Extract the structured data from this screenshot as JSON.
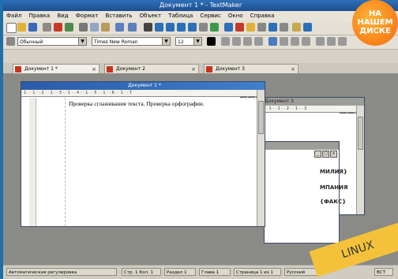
{
  "window": {
    "title": "Документ 1 * - TextMaker"
  },
  "menu": [
    "Файл",
    "Правка",
    "Вид",
    "Формат",
    "Вставить",
    "Объект",
    "Таблица",
    "Сервис",
    "Окно",
    "Справка"
  ],
  "format_bar": {
    "style": "Обычный",
    "font": "Times New Roman",
    "size": "12"
  },
  "tabs": [
    {
      "label": "Документ 1 *"
    },
    {
      "label": "Документ 2"
    },
    {
      "label": "Документ 3"
    }
  ],
  "windows": {
    "doc1": {
      "title": "Документ 1 *",
      "body_text": "Проверка сглаживания текста. Проверка орфографии.",
      "ruler": "· 1 · · 1 · · 2 · · 1 · · 3 · · 1 · · 4 · · 1 · · 5 · · 1 · · 6 · · 1 · · 7"
    },
    "doc3": {
      "title": "Документ 3",
      "ruler": "· · · 1 · · 1 · · 2 · · 1 · · 3"
    },
    "doc2": {
      "fragments": [
        "МИЛИЯ}",
        "МПАНИЯ",
        "{ФАКС}"
      ]
    }
  },
  "status": [
    "Автоматическая регулировка",
    "Стр. 1 Кол. 1",
    "Раздел 1",
    "Глава 1",
    "Страница 1 из 1",
    "Русский",
    "ВСТ"
  ],
  "badge": {
    "line1": "НА",
    "line2": "НАШЕМ",
    "line3": "ДИСКЕ",
    "color": "#f36b08"
  },
  "banner": {
    "text": "LINUX"
  }
}
